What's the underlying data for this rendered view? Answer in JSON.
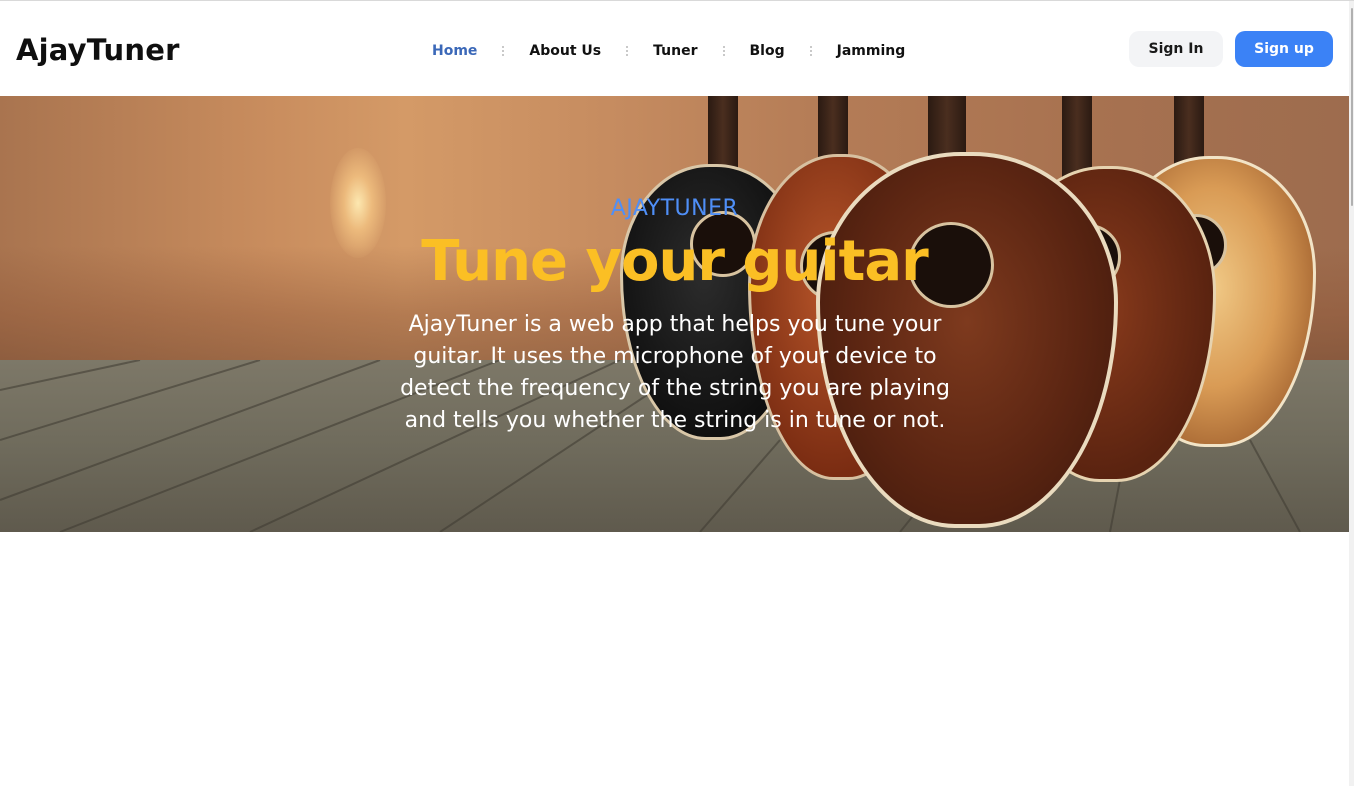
{
  "header": {
    "logo": "AjayTuner",
    "nav": [
      {
        "label": "Home",
        "active": true
      },
      {
        "label": "About Us",
        "active": false
      },
      {
        "label": "Tuner",
        "active": false
      },
      {
        "label": "Blog",
        "active": false
      },
      {
        "label": "Jamming",
        "active": false
      }
    ],
    "signin_label": "Sign In",
    "signup_label": "Sign up"
  },
  "hero": {
    "eyebrow": "AJAYTUNER",
    "title": "Tune your guitar",
    "description": "AjayTuner is a web app that helps you tune your guitar. It uses the microphone of your device to detect the frequency of the string you are playing and tells you whether the string is in tune or not."
  },
  "colors": {
    "accent": "#3b82f6",
    "nav_active": "#3b68b8",
    "title": "#fbbf24",
    "eyebrow": "#4f8ff7"
  }
}
